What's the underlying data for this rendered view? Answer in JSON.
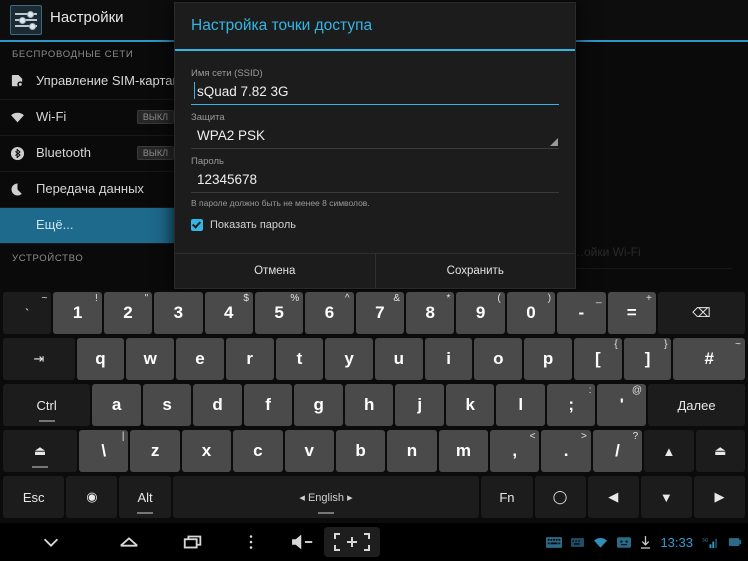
{
  "app": {
    "title": "Настройки",
    "icon": "settings-sliders-icon"
  },
  "sidebar": {
    "section_wireless": "БЕСПРОВОДНЫЕ СЕТИ",
    "section_device": "УСТРОЙСТВО",
    "items": [
      {
        "label": "Управление SIM-картами",
        "icon": "sim-card-icon",
        "toggle": ""
      },
      {
        "label": "Wi-Fi",
        "icon": "wifi-icon",
        "toggle": "ВЫКЛ"
      },
      {
        "label": "Bluetooth",
        "icon": "bluetooth-icon",
        "toggle": "ВЫКЛ"
      },
      {
        "label": "Передача данных",
        "icon": "data-usage-icon",
        "toggle": ""
      },
      {
        "label": "Ещё...",
        "icon": "",
        "toggle": "",
        "selected": true
      }
    ]
  },
  "right_pane": {
    "partial_text": "…ойки Wi-Fi"
  },
  "dialog": {
    "title": "Настройка точки доступа",
    "ssid_label": "Имя сети (SSID)",
    "ssid_value": "sQuad 7.82 3G",
    "security_label": "Защита",
    "security_value": "WPA2 PSK",
    "password_label": "Пароль",
    "password_value": "12345678",
    "password_hint": "В пароле должно быть не менее 8 символов.",
    "show_password_label": "Показать пароль",
    "show_password_checked": true,
    "cancel_label": "Отмена",
    "save_label": "Сохранить",
    "accent_color": "#33b5e5"
  },
  "keyboard": {
    "rows": [
      [
        {
          "main": "`",
          "sup": "~",
          "style": "dk",
          "name": "backtick"
        },
        {
          "main": "1",
          "sup": "!",
          "name": "1"
        },
        {
          "main": "2",
          "sup": "\"",
          "name": "2"
        },
        {
          "main": "3",
          "sup": "",
          "name": "3"
        },
        {
          "main": "4",
          "sup": "$",
          "name": "4"
        },
        {
          "main": "5",
          "sup": "%",
          "name": "5"
        },
        {
          "main": "6",
          "sup": "^",
          "name": "6"
        },
        {
          "main": "7",
          "sup": "&",
          "name": "7"
        },
        {
          "main": "8",
          "sup": "*",
          "name": "8"
        },
        {
          "main": "9",
          "sup": "(",
          "name": "9"
        },
        {
          "main": "0",
          "sup": ")",
          "name": "0"
        },
        {
          "main": "-",
          "sup": "_",
          "name": "minus"
        },
        {
          "main": "=",
          "sup": "+",
          "name": "equals"
        },
        {
          "main": "⌫",
          "sup": "",
          "style": "dk",
          "width": "w18",
          "name": "backspace"
        }
      ],
      [
        {
          "main": "⇥",
          "sup": "",
          "style": "dk",
          "width": "w15",
          "name": "tab"
        },
        {
          "main": "q",
          "sup": "",
          "name": "q"
        },
        {
          "main": "w",
          "sup": "",
          "name": "w"
        },
        {
          "main": "e",
          "sup": "",
          "name": "e"
        },
        {
          "main": "r",
          "sup": "",
          "name": "r"
        },
        {
          "main": "t",
          "sup": "",
          "name": "t"
        },
        {
          "main": "y",
          "sup": "",
          "name": "y"
        },
        {
          "main": "u",
          "sup": "",
          "name": "u"
        },
        {
          "main": "i",
          "sup": "",
          "name": "i"
        },
        {
          "main": "o",
          "sup": "",
          "name": "o"
        },
        {
          "main": "p",
          "sup": "",
          "name": "p"
        },
        {
          "main": "[",
          "sup": "{",
          "name": "bracket-left"
        },
        {
          "main": "]",
          "sup": "}",
          "name": "bracket-right"
        },
        {
          "main": "#",
          "sup": "~",
          "width": "w15",
          "name": "hash"
        }
      ],
      [
        {
          "main": "Ctrl",
          "sup": "",
          "style": "dk",
          "width": "w18",
          "underline": true,
          "name": "ctrl"
        },
        {
          "main": "a",
          "sup": "",
          "name": "a"
        },
        {
          "main": "s",
          "sup": "",
          "name": "s"
        },
        {
          "main": "d",
          "sup": "",
          "name": "d"
        },
        {
          "main": "f",
          "sup": "",
          "name": "f"
        },
        {
          "main": "g",
          "sup": "",
          "name": "g"
        },
        {
          "main": "h",
          "sup": "",
          "name": "h"
        },
        {
          "main": "j",
          "sup": "",
          "name": "j"
        },
        {
          "main": "k",
          "sup": "",
          "name": "k"
        },
        {
          "main": "l",
          "sup": "",
          "name": "l"
        },
        {
          "main": ";",
          "sup": ":",
          "name": "semicolon"
        },
        {
          "main": "'",
          "sup": "@",
          "name": "quote"
        },
        {
          "main": "Далее",
          "sup": "",
          "style": "dk",
          "width": "w20",
          "name": "enter-next"
        }
      ],
      [
        {
          "main": "⏏",
          "sup": "",
          "style": "dk",
          "width": "w15",
          "underline": true,
          "name": "shift-left"
        },
        {
          "main": "\\",
          "sup": "|",
          "name": "backslash"
        },
        {
          "main": "z",
          "sup": "",
          "name": "z"
        },
        {
          "main": "x",
          "sup": "",
          "name": "x"
        },
        {
          "main": "c",
          "sup": "",
          "name": "c"
        },
        {
          "main": "v",
          "sup": "",
          "name": "v"
        },
        {
          "main": "b",
          "sup": "",
          "name": "b"
        },
        {
          "main": "n",
          "sup": "",
          "name": "n"
        },
        {
          "main": "m",
          "sup": "",
          "name": "m"
        },
        {
          "main": ",",
          "sup": "<",
          "name": "comma"
        },
        {
          "main": ".",
          "sup": ">",
          "name": "period"
        },
        {
          "main": "/",
          "sup": "?",
          "name": "slash"
        },
        {
          "main": "▲",
          "sup": "",
          "style": "dk",
          "name": "arrow-up"
        },
        {
          "main": "⏏",
          "sup": "",
          "style": "dk",
          "name": "shift-right"
        }
      ],
      [
        {
          "main": "Esc",
          "sup": "",
          "style": "dk",
          "width": "w18",
          "name": "esc"
        },
        {
          "main": "◉",
          "sup": "",
          "style": "dk",
          "width": "w15",
          "name": "keyboard-settings"
        },
        {
          "main": "Alt",
          "sup": "",
          "style": "dk",
          "width": "w15",
          "underline": true,
          "name": "alt"
        },
        {
          "main": "◂ English ▸",
          "sup": "",
          "style": "sp",
          "width": "sbar",
          "underline": true,
          "name": "spacebar"
        },
        {
          "main": "Fn",
          "sup": "",
          "style": "dk",
          "width": "w15",
          "name": "fn"
        },
        {
          "main": "◯",
          "sup": "",
          "style": "dk",
          "width": "w15",
          "name": "circle-key"
        },
        {
          "main": "◀",
          "sup": "",
          "style": "dk",
          "width": "w15",
          "name": "arrow-left"
        },
        {
          "main": "▼",
          "sup": "",
          "style": "dk",
          "width": "w15",
          "name": "arrow-down"
        },
        {
          "main": "▶",
          "sup": "",
          "style": "dk",
          "width": "w15",
          "name": "arrow-right"
        }
      ]
    ]
  },
  "navbar": {
    "items": [
      "back-icon",
      "home-icon",
      "recents-icon",
      "menu-icon",
      "volume-down-icon",
      "volume-up-icon",
      "screenshot-icon"
    ],
    "clock": "13:33",
    "status_icons": [
      "keyboard-icon",
      "keyboard-small-icon",
      "wifi-icon",
      "smiley-icon",
      "download-icon",
      "signal-3g-icon",
      "battery-icon"
    ],
    "clock_color": "#2f9fd0"
  }
}
